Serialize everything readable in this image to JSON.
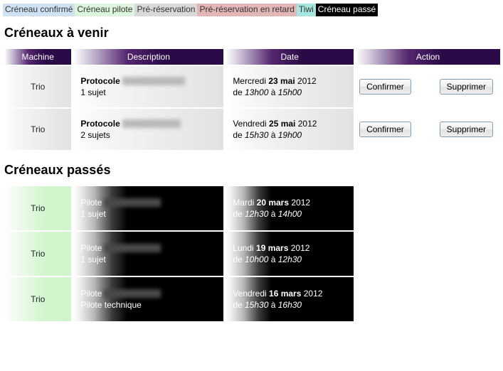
{
  "legend": {
    "items": [
      {
        "label": "Créneau confirmé",
        "bg": "#cfe2f3",
        "fg": "#333333"
      },
      {
        "label": "Créneau pilote",
        "bg": "#ddf5dd",
        "fg": "#333333"
      },
      {
        "label": "Pré-réservation",
        "bg": "#d9d9d9",
        "fg": "#333333"
      },
      {
        "label": "Pré-réservation en retard",
        "bg": "#e2b6b6",
        "fg": "#333333"
      },
      {
        "label": "Tiwi",
        "bg": "#a8e4e0",
        "fg": "#333333"
      },
      {
        "label": "Créneau passé",
        "bg": "#000000",
        "fg": "#ffffff"
      }
    ]
  },
  "sections": {
    "upcoming": {
      "title": "Créneaux à venir",
      "columns": [
        "Machine",
        "Description",
        "Date",
        "Action"
      ],
      "rows": [
        {
          "machine": "Trio",
          "desc_label": "Protocole",
          "desc_redacted": true,
          "redact_width": 88,
          "desc_sub": "1 sujet",
          "date_day": "Mercredi",
          "date_main": "23 mai",
          "date_year": "2012",
          "time_prefix": "de",
          "time_start": "13h00",
          "time_sep": "à",
          "time_end": "15h00",
          "confirm_label": "Confirmer",
          "delete_label": "Supprimer"
        },
        {
          "machine": "Trio",
          "desc_label": "Protocole",
          "desc_redacted": true,
          "redact_width": 82,
          "desc_sub": "2 sujets",
          "date_day": "Vendredi",
          "date_main": "25 mai",
          "date_year": "2012",
          "time_prefix": "de",
          "time_start": "15h30",
          "time_sep": "à",
          "time_end": "19h00",
          "confirm_label": "Confirmer",
          "delete_label": "Supprimer"
        }
      ]
    },
    "past": {
      "title": "Créneaux passés",
      "rows": [
        {
          "machine": "Trio",
          "desc_label": "Pilote",
          "desc_redacted": true,
          "redact_width": 80,
          "desc_sub": "1 sujet",
          "date_day": "Mardi",
          "date_main": "20 mars",
          "date_year": "2012",
          "time_prefix": "de",
          "time_start": "12h30",
          "time_sep": "à",
          "time_end": "14h00"
        },
        {
          "machine": "Trio",
          "desc_label": "Pilote",
          "desc_redacted": true,
          "redact_width": 80,
          "desc_sub": "1 sujet",
          "date_day": "Lundi",
          "date_main": "19 mars",
          "date_year": "2012",
          "time_prefix": "de",
          "time_start": "10h00",
          "time_sep": "à",
          "time_end": "12h30"
        },
        {
          "machine": "Trio",
          "desc_label": "Pilote",
          "desc_redacted": true,
          "redact_width": 80,
          "desc_sub": "Pilote technique",
          "date_day": "Vendredi",
          "date_main": "16 mars",
          "date_year": "2012",
          "time_prefix": "de",
          "time_start": "15h30",
          "time_sep": "à",
          "time_end": "16h30"
        }
      ]
    }
  },
  "colors": {
    "header_dark": "#2a0b47",
    "past_row_bg": "#000000",
    "past_machine_bg": "#d3f5cf"
  }
}
